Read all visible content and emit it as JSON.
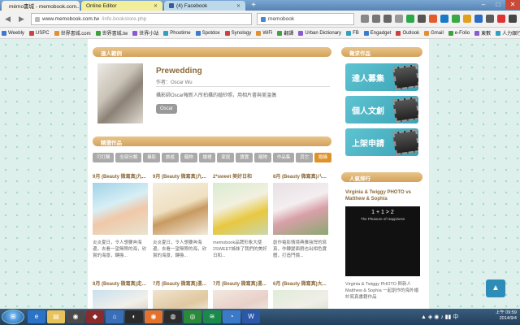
{
  "browser": {
    "tabs": [
      {
        "label": "mémo書城 - memobook.com..."
      },
      {
        "label": "Online Editor"
      },
      {
        "label": "(4) Facebook"
      }
    ],
    "url_domain": "www.memobook.com.tw",
    "url_path": "/info.bookstore.php",
    "search_text": "memobook"
  },
  "bookmarks": [
    "Weebly",
    "USPC",
    "世界書城.com",
    "世界書城.tw",
    "世界小站",
    "Phootime",
    "Spotdox",
    "Synology",
    "WiFi",
    "翻譯",
    "Urban Dictionary",
    "FB",
    "Engadget",
    "Outlook",
    "Gmail",
    "e-Folio",
    "東數",
    "人力銀行",
    "社群"
  ],
  "page": {
    "expert": {
      "bar_label": "達人範例",
      "name": "Prewedding",
      "author": "作者：Oscar Wu",
      "desc": "攝影師Oscar報新人所拍攝的婚紗照，用相片書與美溫偶",
      "tag": "Oscar"
    },
    "works": {
      "bar_label": "精選作品",
      "categories": [
        "可訂購",
        "全部分類",
        "攝影",
        "旅遊",
        "寵物",
        "婚禮",
        "家庭",
        "寶寶",
        "寵物",
        "作品集",
        "其它",
        "婚攝"
      ],
      "row1": [
        {
          "title": "9月 (Beauty 微寫真)九...",
          "desc": "炎炎夏日，令人想要奔海邊，去看一望無際的海，欣賞的海景，轉換..."
        },
        {
          "title": "9月 (Beauty 微寫真)九...",
          "desc": "炎炎夏日，令人想要奔海邊，去看一望無際的海，欣賞的海景，轉換..."
        },
        {
          "title": "2*sweet 美好日和",
          "desc": "memobook品牌形象大使2SWEET姊妹了我們的美好日和..."
        },
        {
          "title": "8月 (Beauty 微寫真)八...",
          "desc": "創作電影情境典雅強悍的寫真，作轉變面貌也出相色寶體，打造門價..."
        }
      ],
      "row2": [
        {
          "title": "8月 (Beauty 微寫真)走..."
        },
        {
          "title": "7月 (Beauty 微寫真)漫..."
        },
        {
          "title": "7月 (Beauty 微寫真)漫..."
        },
        {
          "title": "6月 (Beauty 微寫真)大..."
        }
      ]
    },
    "sidebar": {
      "bar_label": "徵求作品",
      "promos": [
        "達人募集",
        "個人文創",
        "上架申請"
      ],
      "rank_bar_label": "人氣排行",
      "rank_title": "Virginia & Twiggy PHOTO vs Matthew & Sophia",
      "rank_img_text": "1 + 1 > 2",
      "rank_img_sub": "The Pleasure of Happiness",
      "rank_desc": "Virginia & Twiggy PHOTO 與新人 Matthew & Sophia 一起創作的海外婚紗寫真書籍作品"
    }
  },
  "taskbar": {
    "time": "上午 09:59",
    "date": "2014/9/4"
  }
}
